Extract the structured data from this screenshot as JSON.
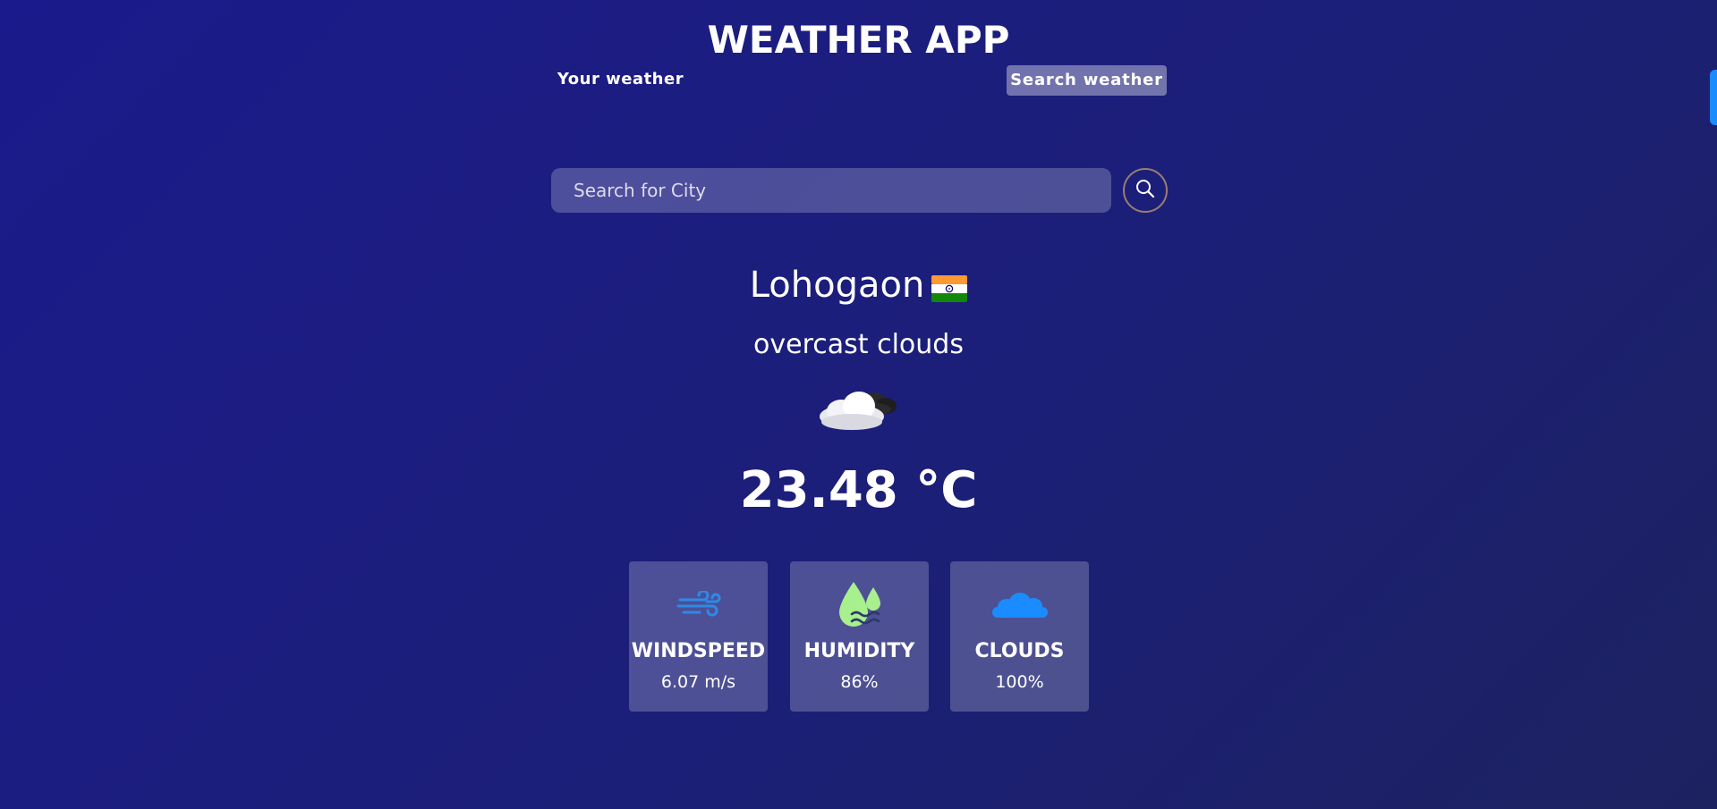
{
  "app": {
    "title": "WEATHER APP"
  },
  "tabs": {
    "your_weather": "Your weather",
    "search_weather": "Search weather"
  },
  "search": {
    "placeholder": "Search for City",
    "value": ""
  },
  "current": {
    "city": "Lohogaon",
    "country_flag": "India flag",
    "description": "overcast clouds",
    "weather_icon": "overcast-cloud-icon",
    "temperature": "23.48 °C"
  },
  "stats": [
    {
      "label": "WINDSPEED",
      "value": "6.07 m/s",
      "icon": "wind-icon"
    },
    {
      "label": "HUMIDITY",
      "value": "86%",
      "icon": "humidity-icon"
    },
    {
      "label": "CLOUDS",
      "value": "100%",
      "icon": "cloud-icon"
    }
  ],
  "colors": {
    "background_start": "#1b1a8c",
    "background_end": "#1c2260",
    "accent_blue": "#1a8cff",
    "humidity_green": "#a8ef8e",
    "search_ring": "#9a7d70"
  }
}
